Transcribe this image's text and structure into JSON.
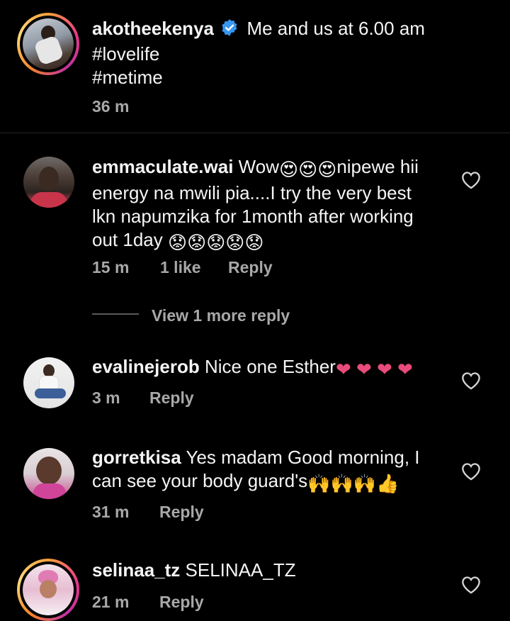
{
  "caption": {
    "username": "akotheekenya",
    "text": "Me and us at 6.00 am",
    "hashtags": [
      "#lovelife",
      "#metime"
    ],
    "time": "36 m"
  },
  "view_more": "View 1 more reply",
  "reply_label": "Reply",
  "comments": [
    {
      "username": "emmaculate.wai",
      "text_1": "Wow",
      "text_2": "nipewe hii energy na mwili pia....I try the very best lkn napumzika for 1month after working out 1day",
      "time": "15 m",
      "likes": "1 like"
    },
    {
      "username": "evalinejerob",
      "text": "Nice one Esther",
      "time": "3 m"
    },
    {
      "username": "gorretkisa",
      "text": "Yes madam Good morning, I can see your body guard's",
      "time": "31 m"
    },
    {
      "username": "selinaa_tz",
      "text": "SELINAA_TZ",
      "time": "21 m"
    }
  ],
  "colors": {
    "background": "#000000",
    "text": "#f5f5f5",
    "meta": "#a8a8a8",
    "verified": "#3797f0",
    "heart_emoji": "#e94c7b",
    "divider": "#262626"
  },
  "icons": [
    "verified-badge-icon",
    "heart-outline-icon",
    "heart-eyes-emoji",
    "sad-face-emoji",
    "heart-emoji",
    "raised-hands-emoji",
    "thumbs-up-emoji"
  ]
}
